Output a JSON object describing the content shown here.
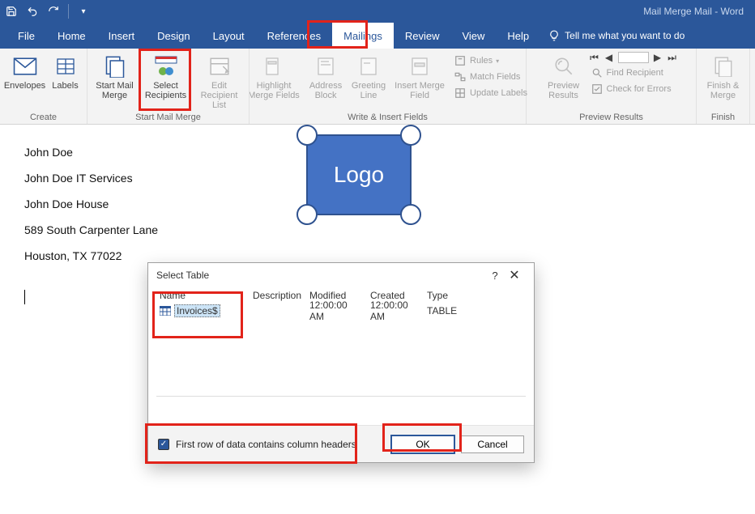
{
  "title": "Mail Merge Mail  -  Word",
  "tabs": {
    "file": "File",
    "home": "Home",
    "insert": "Insert",
    "design": "Design",
    "layout": "Layout",
    "references": "References",
    "mailings": "Mailings",
    "review": "Review",
    "view": "View",
    "help": "Help",
    "tellme": "Tell me what you want to do"
  },
  "ribbon": {
    "create": {
      "envelopes": "Envelopes",
      "labels": "Labels",
      "name": "Create"
    },
    "start": {
      "startmm": "Start Mail Merge",
      "select": "Select Recipients",
      "edit": "Edit Recipient List",
      "name": "Start Mail Merge"
    },
    "write": {
      "highlight": "Highlight Merge Fields",
      "address": "Address Block",
      "greeting": "Greeting Line",
      "insertmf": "Insert Merge Field",
      "rules": "Rules",
      "match": "Match Fields",
      "update": "Update Labels",
      "name": "Write & Insert Fields"
    },
    "preview": {
      "preview": "Preview Results",
      "find": "Find Recipient",
      "check": "Check for Errors",
      "name": "Preview Results"
    },
    "finish": {
      "finish": "Finish & Merge",
      "name": "Finish"
    }
  },
  "doc": {
    "l1": "John Doe",
    "l2": "John Doe IT Services",
    "l3": "John Doe House",
    "l4": "589 South Carpenter Lane",
    "l5": "Houston, TX 77022",
    "logo": "Logo"
  },
  "dialog": {
    "title": "Select Table",
    "cols": {
      "name": "Name",
      "desc": "Description",
      "mod": "Modified",
      "cre": "Created",
      "type": "Type"
    },
    "row": {
      "name": "Invoices$",
      "desc": "",
      "mod": "12:00:00 AM",
      "cre": "12:00:00 AM",
      "type": "TABLE"
    },
    "checkbox": "First row of data contains column headers",
    "ok": "OK",
    "cancel": "Cancel"
  }
}
